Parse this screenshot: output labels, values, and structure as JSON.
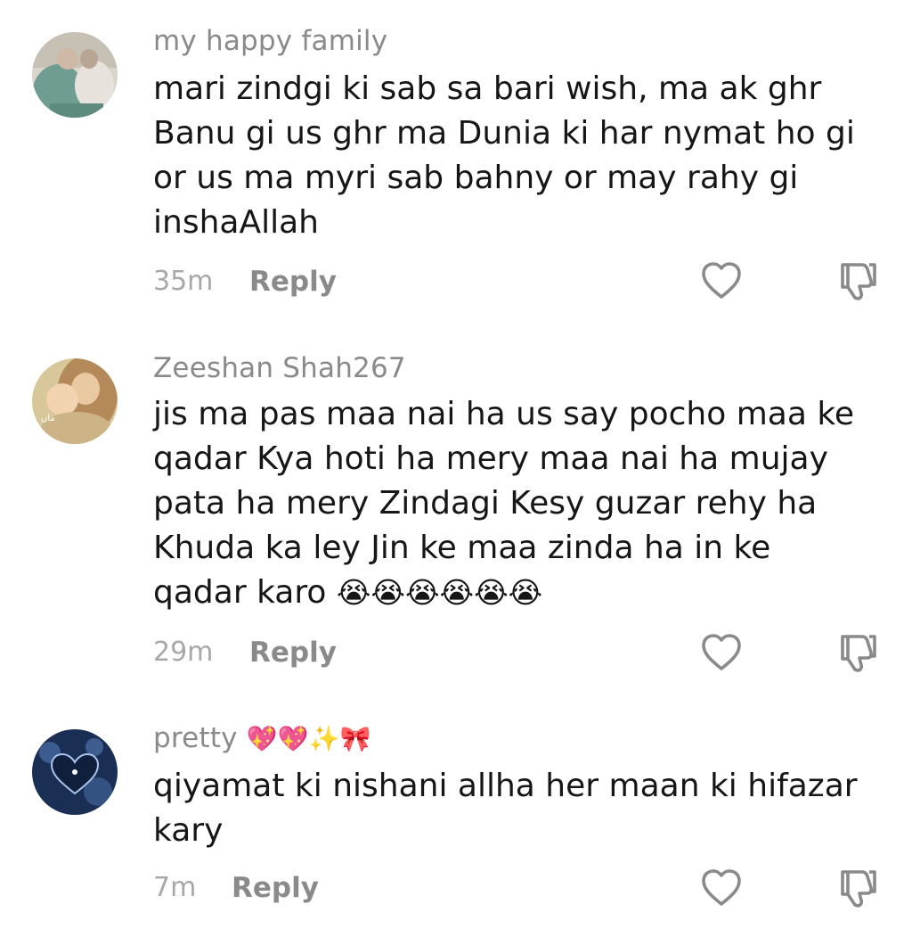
{
  "comments": [
    {
      "username": "my happy family",
      "text": "mari zindgi ki sab sa bari wish, ma ak ghr\nBanu gi us ghr ma Dunia ki har nymat ho gi\nor us ma myri sab bahny or may rahy gi\ninshaAllah",
      "time": "35m",
      "reply_label": "Reply",
      "avatar_icon": "family-photo-avatar",
      "like_icon": "heart-outline-icon",
      "dislike_icon": "thumbs-down-icon"
    },
    {
      "username": "Zeeshan Shah267",
      "text": "jis ma pas maa nai ha us say pocho maa ke\nqadar Kya hoti ha mery maa nai ha mujay\npata ha mery Zindagi Kesy guzar rehy ha\nKhuda ka ley Jin ke maa zinda ha in ke\nqadar karo",
      "emojis": "😭😭😭😭😭😭",
      "time": "29m",
      "reply_label": "Reply",
      "avatar_icon": "mother-child-painting-avatar",
      "like_icon": "heart-outline-icon",
      "dislike_icon": "thumbs-down-icon"
    },
    {
      "username": "pretty",
      "username_emojis": "💖💖✨🎀",
      "text": "qiyamat ki nishani allha her maan ki hifazar\nkary",
      "time": "7m",
      "reply_label": "Reply",
      "avatar_icon": "heart-night-sky-avatar",
      "like_icon": "heart-outline-icon",
      "dislike_icon": "thumbs-down-icon"
    }
  ],
  "colors": {
    "username": "#8a8a8a",
    "text": "#161616",
    "time": "#a8a8a8",
    "icon": "#8a8a8a",
    "background": "#ffffff"
  }
}
